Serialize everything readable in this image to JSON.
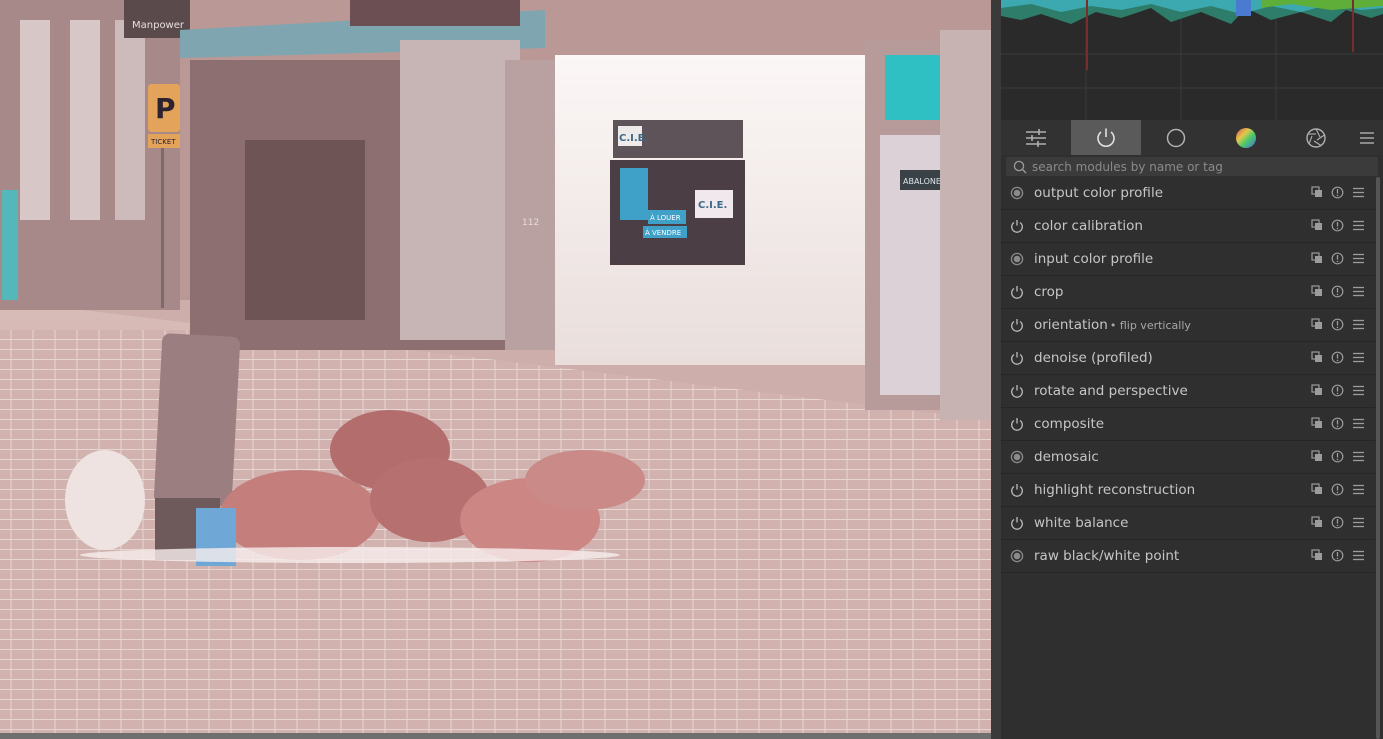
{
  "colors": {
    "panel_bg": "#2f2f2f",
    "tab_active_bg": "#5a5a5a",
    "module_text": "#c6c6c6",
    "icon_gray": "#9c9c9c"
  },
  "tabs": [
    {
      "name": "quick-access-tab",
      "icon": "sliders-icon",
      "active": false
    },
    {
      "name": "active-modules-tab",
      "icon": "power-icon",
      "active": true
    },
    {
      "name": "base-group-tab",
      "icon": "circle-icon",
      "active": false
    },
    {
      "name": "color-group-tab",
      "icon": "color-wheel-icon",
      "active": false
    },
    {
      "name": "effects-group-tab",
      "icon": "aperture-icon",
      "active": false
    },
    {
      "name": "presets-menu-tab",
      "icon": "hamburger-icon",
      "active": false
    }
  ],
  "search": {
    "placeholder": "search modules by name or tag",
    "value": ""
  },
  "modules": [
    {
      "label": "output color profile",
      "sublabel": "",
      "state": "always-on"
    },
    {
      "label": "color calibration",
      "sublabel": "",
      "state": "on"
    },
    {
      "label": "input color profile",
      "sublabel": "",
      "state": "always-on"
    },
    {
      "label": "crop",
      "sublabel": "",
      "state": "on"
    },
    {
      "label": "orientation",
      "sublabel": "• flip vertically",
      "state": "on"
    },
    {
      "label": "denoise (profiled)",
      "sublabel": "",
      "state": "on"
    },
    {
      "label": "rotate and perspective",
      "sublabel": "",
      "state": "on"
    },
    {
      "label": "composite",
      "sublabel": "",
      "state": "on"
    },
    {
      "label": "demosaic",
      "sublabel": "",
      "state": "always-on"
    },
    {
      "label": "highlight reconstruction",
      "sublabel": "",
      "state": "on"
    },
    {
      "label": "white balance",
      "sublabel": "",
      "state": "on"
    },
    {
      "label": "raw black/white point",
      "sublabel": "",
      "state": "always-on"
    }
  ],
  "image_signs": {
    "manpower": "Manpower",
    "parking": "P",
    "ticket": "TICKET",
    "cie_1": "C.I.E.",
    "cie_2": "C.I.E.",
    "a_vendre": "À VENDRE",
    "a_louer": "À LOUER",
    "abalone": "ABALONE",
    "house_number": "112"
  }
}
